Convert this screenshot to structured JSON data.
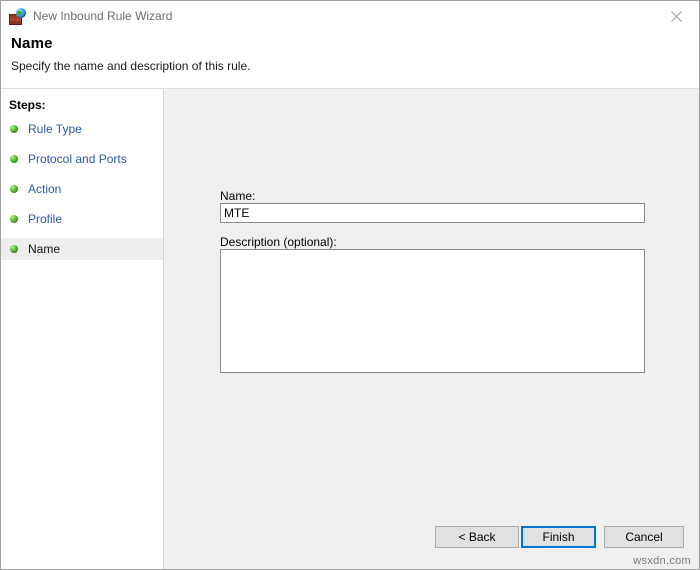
{
  "window": {
    "title": "New Inbound Rule Wizard",
    "app_icon": "firewall-icon",
    "close_label": "✕"
  },
  "header": {
    "title": "Name",
    "subtitle": "Specify the name and description of this rule."
  },
  "sidebar": {
    "heading": "Steps:",
    "items": [
      {
        "label": "Rule Type",
        "current": false,
        "bullet": "green-sphere-bullet"
      },
      {
        "label": "Protocol and Ports",
        "current": false,
        "bullet": "green-sphere-bullet"
      },
      {
        "label": "Action",
        "current": false,
        "bullet": "green-sphere-bullet"
      },
      {
        "label": "Profile",
        "current": false,
        "bullet": "green-sphere-bullet"
      },
      {
        "label": "Name",
        "current": true,
        "bullet": "green-sphere-bullet"
      }
    ]
  },
  "form": {
    "name_label": "Name:",
    "name_value": "MTE",
    "name_placeholder": "",
    "description_label": "Description (optional):",
    "description_value": "",
    "description_placeholder": ""
  },
  "footer": {
    "back_label": "< Back",
    "finish_label": "Finish",
    "cancel_label": "Cancel",
    "focused_button": "Finish"
  },
  "watermark": {
    "text": "wsxdn.com"
  },
  "colors": {
    "accent_focus": "#0078D7",
    "link": "#2B5AA8",
    "pane_background": "#F0F0F0",
    "button_face": "#E1E1E1",
    "bullet_green": "#5DC239",
    "title_text": "#6D6D6D"
  }
}
